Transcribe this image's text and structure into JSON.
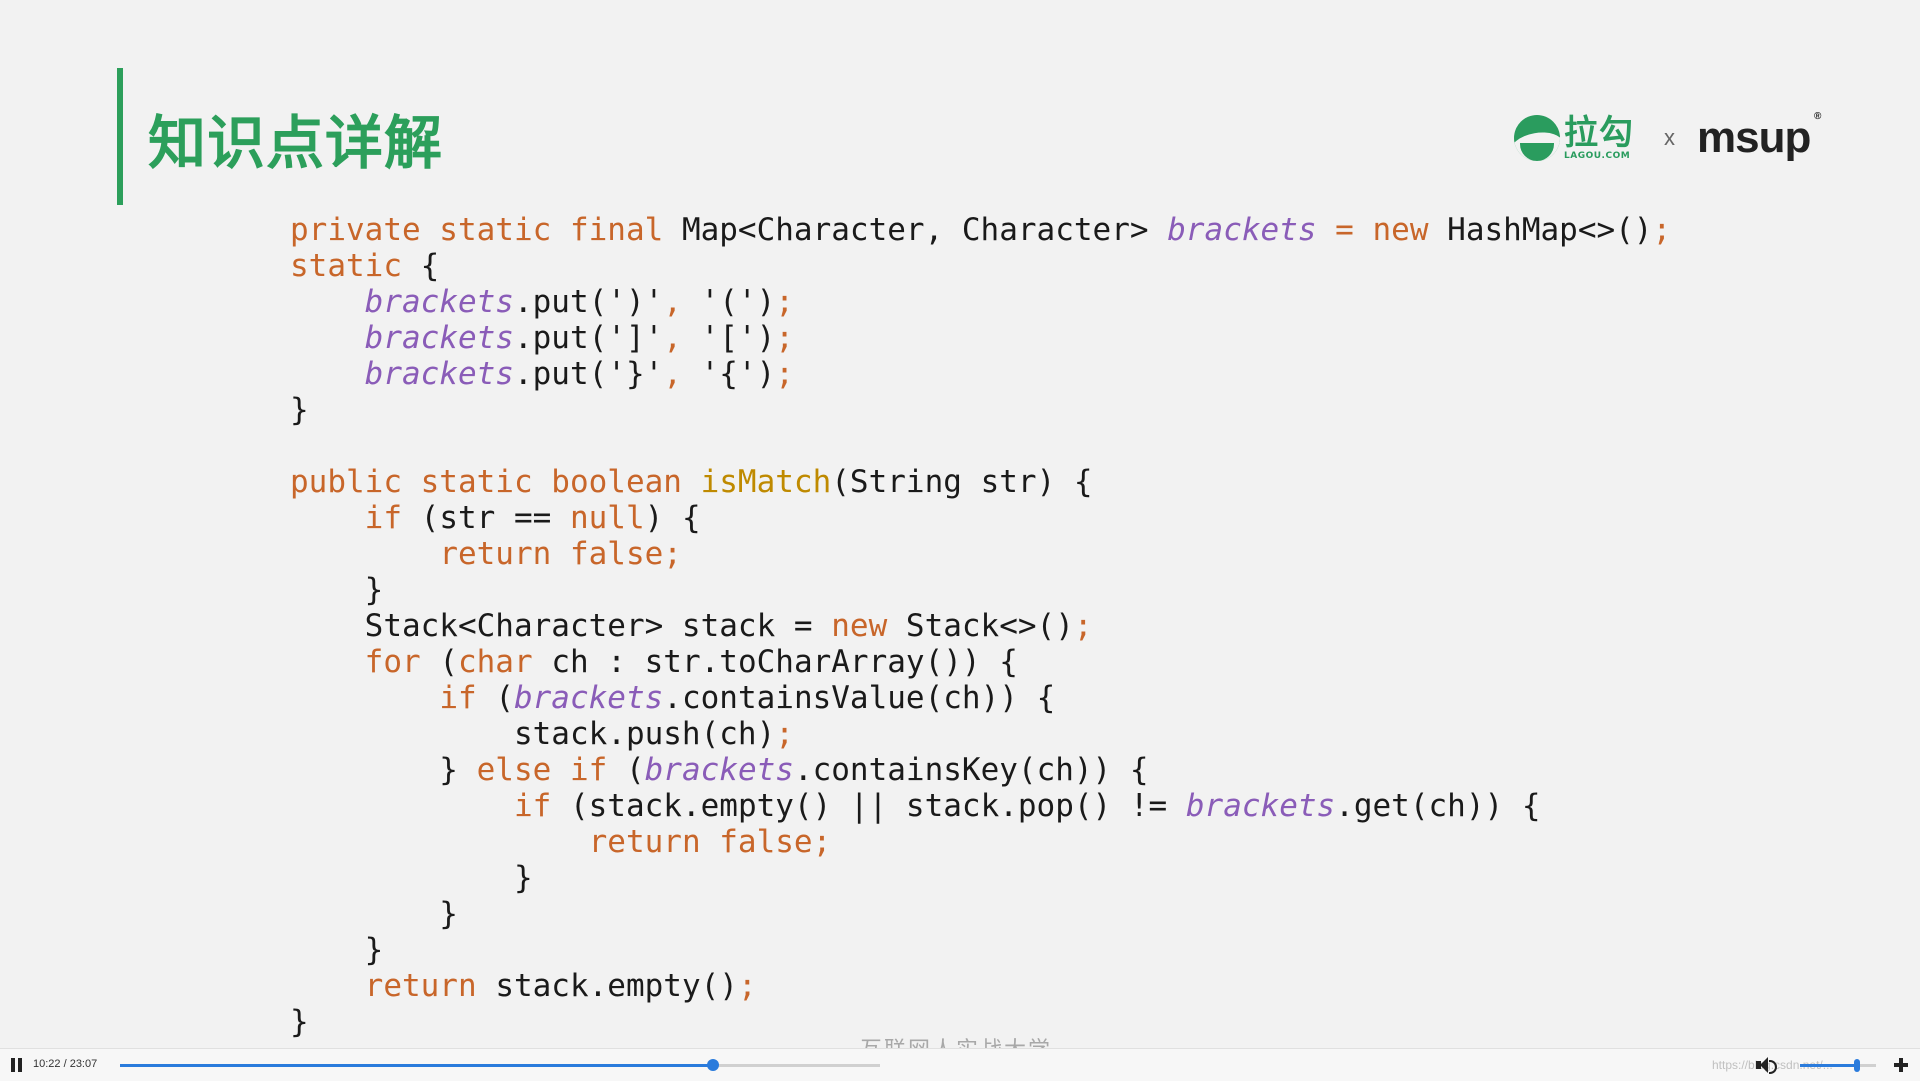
{
  "slide": {
    "title": "知识点详解",
    "logo_lagou_cn": "拉勾",
    "logo_lagou_en": "LAGOU.COM",
    "logo_separator": "x",
    "logo_msup": "msup",
    "logo_msup_mark": "®",
    "watermark": "互联网人实战大学"
  },
  "code_lines": [
    [
      [
        "kw",
        "private static final "
      ],
      [
        "",
        "Map<Character, Character> "
      ],
      [
        "fld",
        "brackets"
      ],
      [
        "pun",
        " = "
      ],
      [
        "kw",
        "new "
      ],
      [
        "",
        "HashMap<>()"
      ],
      [
        "pun",
        ";"
      ]
    ],
    [
      [
        "kw",
        "static "
      ],
      [
        "",
        "{"
      ]
    ],
    [
      [
        "",
        "    "
      ],
      [
        "fld",
        "brackets"
      ],
      [
        "",
        ".put(')'"
      ],
      [
        "pun",
        ", "
      ],
      [
        "",
        "'(')"
      ],
      [
        "pun",
        ";"
      ]
    ],
    [
      [
        "",
        "    "
      ],
      [
        "fld",
        "brackets"
      ],
      [
        "",
        ".put(']'"
      ],
      [
        "pun",
        ", "
      ],
      [
        "",
        "'[')"
      ],
      [
        "pun",
        ";"
      ]
    ],
    [
      [
        "",
        "    "
      ],
      [
        "fld",
        "brackets"
      ],
      [
        "",
        ".put('}'"
      ],
      [
        "pun",
        ", "
      ],
      [
        "",
        "'{')"
      ],
      [
        "pun",
        ";"
      ]
    ],
    [
      [
        "",
        "}"
      ]
    ],
    [
      [
        "",
        ""
      ]
    ],
    [
      [
        "kw",
        "public static boolean "
      ],
      [
        "mth",
        "isMatch"
      ],
      [
        "",
        "(String str) {"
      ]
    ],
    [
      [
        "",
        "    "
      ],
      [
        "kw",
        "if "
      ],
      [
        "",
        "(str == "
      ],
      [
        "kw",
        "null"
      ],
      [
        "",
        ") {"
      ]
    ],
    [
      [
        "",
        "        "
      ],
      [
        "kw",
        "return false;"
      ]
    ],
    [
      [
        "",
        "    }"
      ]
    ],
    [
      [
        "",
        "    Stack<Character> stack = "
      ],
      [
        "kw",
        "new "
      ],
      [
        "",
        "Stack<>()"
      ],
      [
        "pun",
        ";"
      ]
    ],
    [
      [
        "",
        "    "
      ],
      [
        "kw",
        "for "
      ],
      [
        "",
        "("
      ],
      [
        "kw",
        "char "
      ],
      [
        "",
        "ch : str.toCharArray()) {"
      ]
    ],
    [
      [
        "",
        "        "
      ],
      [
        "kw",
        "if "
      ],
      [
        "",
        "("
      ],
      [
        "fld",
        "brackets"
      ],
      [
        "",
        ".containsValue(ch)) {"
      ]
    ],
    [
      [
        "",
        "            stack.push(ch)"
      ],
      [
        "pun",
        ";"
      ]
    ],
    [
      [
        "",
        "        } "
      ],
      [
        "kw",
        "else if "
      ],
      [
        "",
        "("
      ],
      [
        "fld",
        "brackets"
      ],
      [
        "",
        ".containsKey(ch)) {"
      ]
    ],
    [
      [
        "",
        "            "
      ],
      [
        "kw",
        "if "
      ],
      [
        "",
        "(stack.empty() || stack.pop() != "
      ],
      [
        "fld",
        "brackets"
      ],
      [
        "",
        ".get(ch)) {"
      ]
    ],
    [
      [
        "",
        "                "
      ],
      [
        "kw",
        "return false;"
      ]
    ],
    [
      [
        "",
        "            }"
      ]
    ],
    [
      [
        "",
        "        }"
      ]
    ],
    [
      [
        "",
        "    }"
      ]
    ],
    [
      [
        "",
        "    "
      ],
      [
        "kw",
        "return "
      ],
      [
        "",
        "stack.empty()"
      ],
      [
        "pun",
        ";"
      ]
    ],
    [
      [
        "",
        "}"
      ]
    ]
  ],
  "player": {
    "time": "10:22 / 23:07",
    "progress": 0.78,
    "volume": 0.75,
    "url_watermark": "https://blog.csdn.net/..."
  },
  "colors": {
    "accent_green": "#2c9f5b",
    "keyword_orange": "#c8662a",
    "field_purple": "#8a5cb8",
    "method_gold": "#bf8a00",
    "player_blue": "#2a7bdc"
  },
  "icons": {
    "play_pause": "pause-icon",
    "volume": "volume-icon",
    "fullscreen": "fullscreen-exit-icon"
  }
}
